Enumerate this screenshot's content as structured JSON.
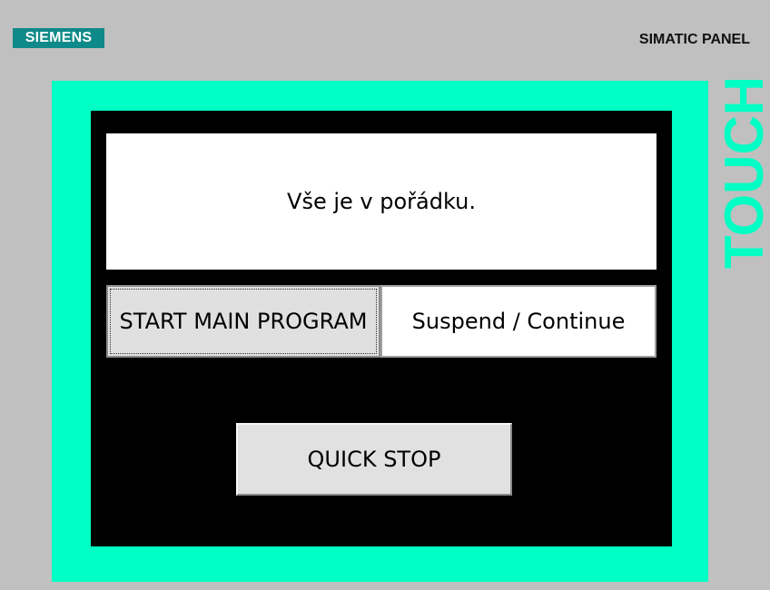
{
  "header": {
    "brand": "SIEMENS",
    "panel_model": "SIMATIC PANEL",
    "touch_label": "TOUCH"
  },
  "screen": {
    "status_message": "Vše je v pořádku.",
    "buttons": {
      "start": "START MAIN PROGRAM",
      "suspend": "Suspend / Continue",
      "quick_stop": "QUICK STOP"
    }
  },
  "colors": {
    "bezel": "#00ffc4",
    "brand_badge": "#0f8989",
    "background": "#c0c0c0",
    "screen": "#000000"
  }
}
